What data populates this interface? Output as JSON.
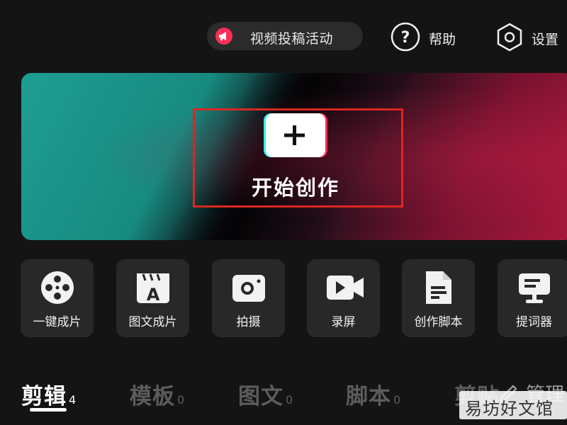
{
  "header": {
    "promo_label": "视频投稿活动",
    "help_label": "帮助",
    "settings_label": "设置"
  },
  "hero": {
    "label": "开始创作"
  },
  "tools": [
    {
      "label": "一键成片",
      "icon": "film-reel-icon"
    },
    {
      "label": "图文成片",
      "icon": "clapper-a-icon"
    },
    {
      "label": "拍摄",
      "icon": "camera-icon"
    },
    {
      "label": "录屏",
      "icon": "video-camera-icon"
    },
    {
      "label": "创作脚本",
      "icon": "document-icon"
    },
    {
      "label": "提词器",
      "icon": "teleprompter-icon"
    }
  ],
  "tabs": [
    {
      "label": "剪辑",
      "count": "4",
      "active": true
    },
    {
      "label": "模板",
      "count": "0",
      "active": false
    },
    {
      "label": "图文",
      "count": "0",
      "active": false
    },
    {
      "label": "脚本",
      "count": "0",
      "active": false
    },
    {
      "label": "剪贴",
      "count": "",
      "active": false
    }
  ],
  "manage_label": "管理",
  "watermark": "易坊好文馆",
  "colors": {
    "background": "#141414",
    "accent_red": "#fe2c55",
    "accent_cyan": "#2ef0ea",
    "highlight_box": "#d9281f"
  }
}
